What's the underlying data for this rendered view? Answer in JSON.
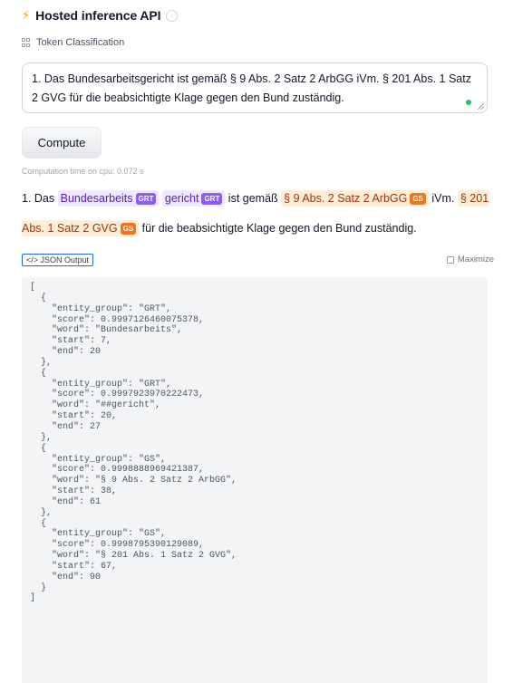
{
  "header": {
    "title": "Hosted inference API"
  },
  "task": {
    "label": "Token Classification"
  },
  "input": {
    "text": "1. Das Bundesarbeitsgericht ist gemäß § 9 Abs. 2 Satz 2 ArbGG iVm. § 201 Abs. 1 Satz 2 GVG für die beabsichtigte Klage gegen den Bund zuständig."
  },
  "compute_button": {
    "label": "Compute"
  },
  "computation_time": "Computation time on cpu: 0.072 s",
  "result": {
    "t0": "1. Das ",
    "e1": "Bundesarbeits",
    "e1_tag": "GRT",
    "e2": "gericht",
    "e2_tag": "GRT",
    "t1": " ist gemäß ",
    "e3": "§ 9 Abs. 2 Satz 2 ArbGG",
    "e3_tag": "GS",
    "t2": " iVm. ",
    "e4": "§ 201 Abs. 1 Satz 2 GVG",
    "e4_tag": "GS",
    "t3": " für die beabsichtigte Klage gegen den Bund zuständig."
  },
  "json_tab": {
    "label": "JSON Output"
  },
  "maximize": {
    "label": "Maximize"
  },
  "json_output": "[\n  {\n    \"entity_group\": \"GRT\",\n    \"score\": 0.9997126460075378,\n    \"word\": \"Bundesarbeits\",\n    \"start\": 7,\n    \"end\": 20\n  },\n  {\n    \"entity_group\": \"GRT\",\n    \"score\": 0.9997923970222473,\n    \"word\": \"##gericht\",\n    \"start\": 20,\n    \"end\": 27\n  },\n  {\n    \"entity_group\": \"GS\",\n    \"score\": 0.9998888969421387,\n    \"word\": \"§ 9 Abs. 2 Satz 2 ArbGG\",\n    \"start\": 38,\n    \"end\": 61\n  },\n  {\n    \"entity_group\": \"GS\",\n    \"score\": 0.9998795390129089,\n    \"word\": \"§ 201 Abs. 1 Satz 2 GVG\",\n    \"start\": 67,\n    \"end\": 90\n  }\n]",
  "colors": {
    "accent": "#f59e0b",
    "grt_bg": "#ede9fe",
    "grt_tag": "#8b5cf6",
    "gs_bg": "#ffedd5",
    "gs_tag": "#f97316",
    "status_dot": "#22c55e"
  },
  "icons": [
    "lightning-icon",
    "info-icon",
    "token-classification-icon",
    "code-icon",
    "maximize-icon"
  ]
}
